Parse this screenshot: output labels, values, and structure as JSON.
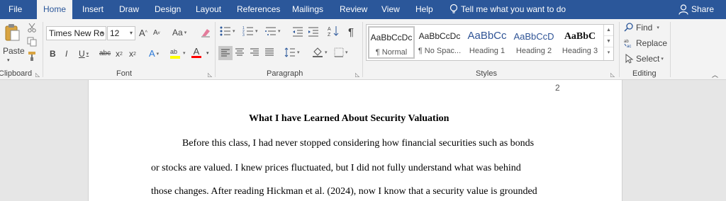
{
  "menu": {
    "items": [
      "File",
      "Home",
      "Insert",
      "Draw",
      "Design",
      "Layout",
      "References",
      "Mailings",
      "Review",
      "View",
      "Help"
    ],
    "active": "Home",
    "tell_me": "Tell me what you want to do",
    "share": "Share"
  },
  "clipboard": {
    "paste_label": "Paste",
    "group_label": "Clipboard"
  },
  "font": {
    "name": "Times New Ro",
    "size": "12",
    "grow": "A",
    "shrink": "A",
    "change_case": "Aa",
    "bold": "B",
    "italic": "I",
    "underline": "U",
    "strikethrough": "abc",
    "subscript": "x",
    "superscript": "x",
    "text_effects": "A",
    "font_color": "A",
    "group_label": "Font"
  },
  "paragraph": {
    "pilcrow": "¶",
    "group_label": "Paragraph"
  },
  "styles": {
    "tiles": [
      {
        "preview": "AaBbCcDc",
        "name": "¶ Normal"
      },
      {
        "preview": "AaBbCcDc",
        "name": "¶ No Spac..."
      },
      {
        "preview": "AaBbCc",
        "name": "Heading 1"
      },
      {
        "preview": "AaBbCcD",
        "name": "Heading 2"
      },
      {
        "preview": "AaBbC",
        "name": "Heading 3"
      }
    ],
    "group_label": "Styles"
  },
  "editing": {
    "find": "Find",
    "replace": "Replace",
    "select": "Select",
    "group_label": "Editing"
  },
  "colors": {
    "brand": "#2b579a",
    "highlight": "#ffff00",
    "font_color": "#ff0000",
    "heading": "#2f5496"
  },
  "document": {
    "page_number": "2",
    "title": "What I have Learned About Security Valuation",
    "lines": [
      "Before this class, I had never stopped considering how financial securities such as bonds",
      "or stocks are valued. I knew prices fluctuated, but I did not fully understand what was behind",
      "those changes. After reading Hickman et al. (2024), now I know that a security value is grounded"
    ]
  }
}
